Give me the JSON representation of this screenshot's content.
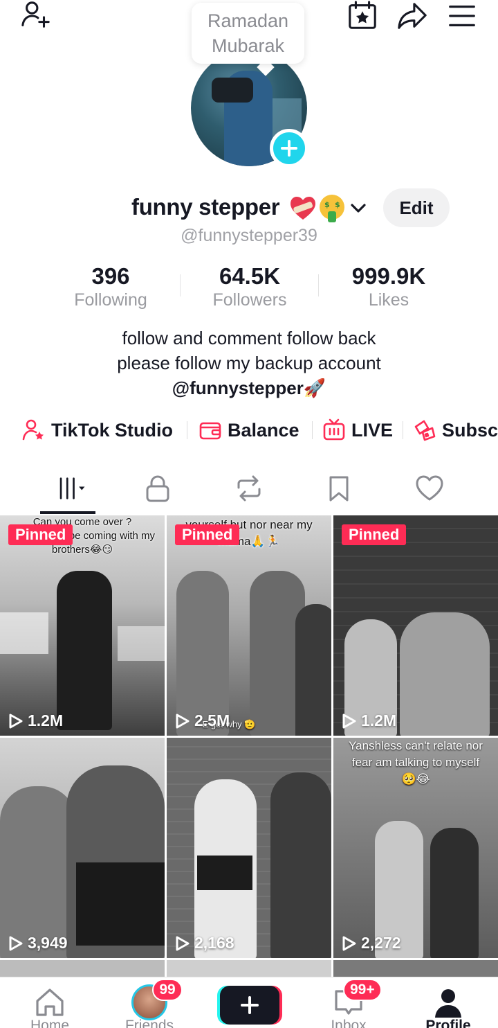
{
  "popup": {
    "line1": "Ramadan",
    "line2": "Mubarak"
  },
  "profile": {
    "display_name": "funny stepper",
    "name_emojis": [
      "heart-with-bandage-emoji",
      "money-mouth-face-emoji"
    ],
    "handle": "@funnystepper39",
    "edit_label": "Edit"
  },
  "stats": [
    {
      "value": "396",
      "label": "Following"
    },
    {
      "value": "64.5K",
      "label": "Followers"
    },
    {
      "value": "999.9K",
      "label": "Likes"
    }
  ],
  "bio": {
    "line1": "follow and comment follow back",
    "line2": "please follow my backup account",
    "line3": "@funnystepper🚀"
  },
  "quick_links": [
    {
      "label": "TikTok Studio",
      "icon": "creator-icon"
    },
    {
      "label": "Balance",
      "icon": "wallet-icon"
    },
    {
      "label": "LIVE",
      "icon": "live-tv-icon"
    },
    {
      "label": "Subsc",
      "icon": "subscription-icon"
    }
  ],
  "tabs": [
    {
      "name": "videos",
      "icon": "grid-icon",
      "active": true
    },
    {
      "name": "private",
      "icon": "lock-icon"
    },
    {
      "name": "reposts",
      "icon": "repost-icon"
    },
    {
      "name": "favorites",
      "icon": "bookmark-icon"
    },
    {
      "name": "liked",
      "icon": "heart-icon"
    }
  ],
  "videos": [
    {
      "views": "1.2M",
      "pinned": "Pinned",
      "caption": "Can you come over ?\nyes but I will be coming with my\nbrothers😂😏"
    },
    {
      "views": "2.5M",
      "pinned": "Pinned",
      "caption": "yourself but nor near my\nmama🙏🏃",
      "overlay": "E get why 🫡"
    },
    {
      "views": "1.2M",
      "pinned": "Pinned"
    },
    {
      "views": "3,949"
    },
    {
      "views": "2,168"
    },
    {
      "views": "2,272",
      "caption": "Yanshless can't relate nor\nfear am talking to myself\n🥺😂"
    }
  ],
  "bottom_nav": [
    {
      "label": "Home",
      "icon": "home-icon"
    },
    {
      "label": "Friends",
      "icon": "friends-avatar",
      "badge": "99"
    },
    {
      "label": "",
      "icon": "plus-icon"
    },
    {
      "label": "Inbox",
      "icon": "inbox-icon",
      "badge": "99+"
    },
    {
      "label": "Profile",
      "icon": "profile-icon",
      "active": true
    }
  ],
  "colors": {
    "accent": "#fe2c55",
    "cyan": "#25f4ee",
    "add_button": "#20d5ec",
    "text": "#161823",
    "muted": "#8a8b91"
  }
}
